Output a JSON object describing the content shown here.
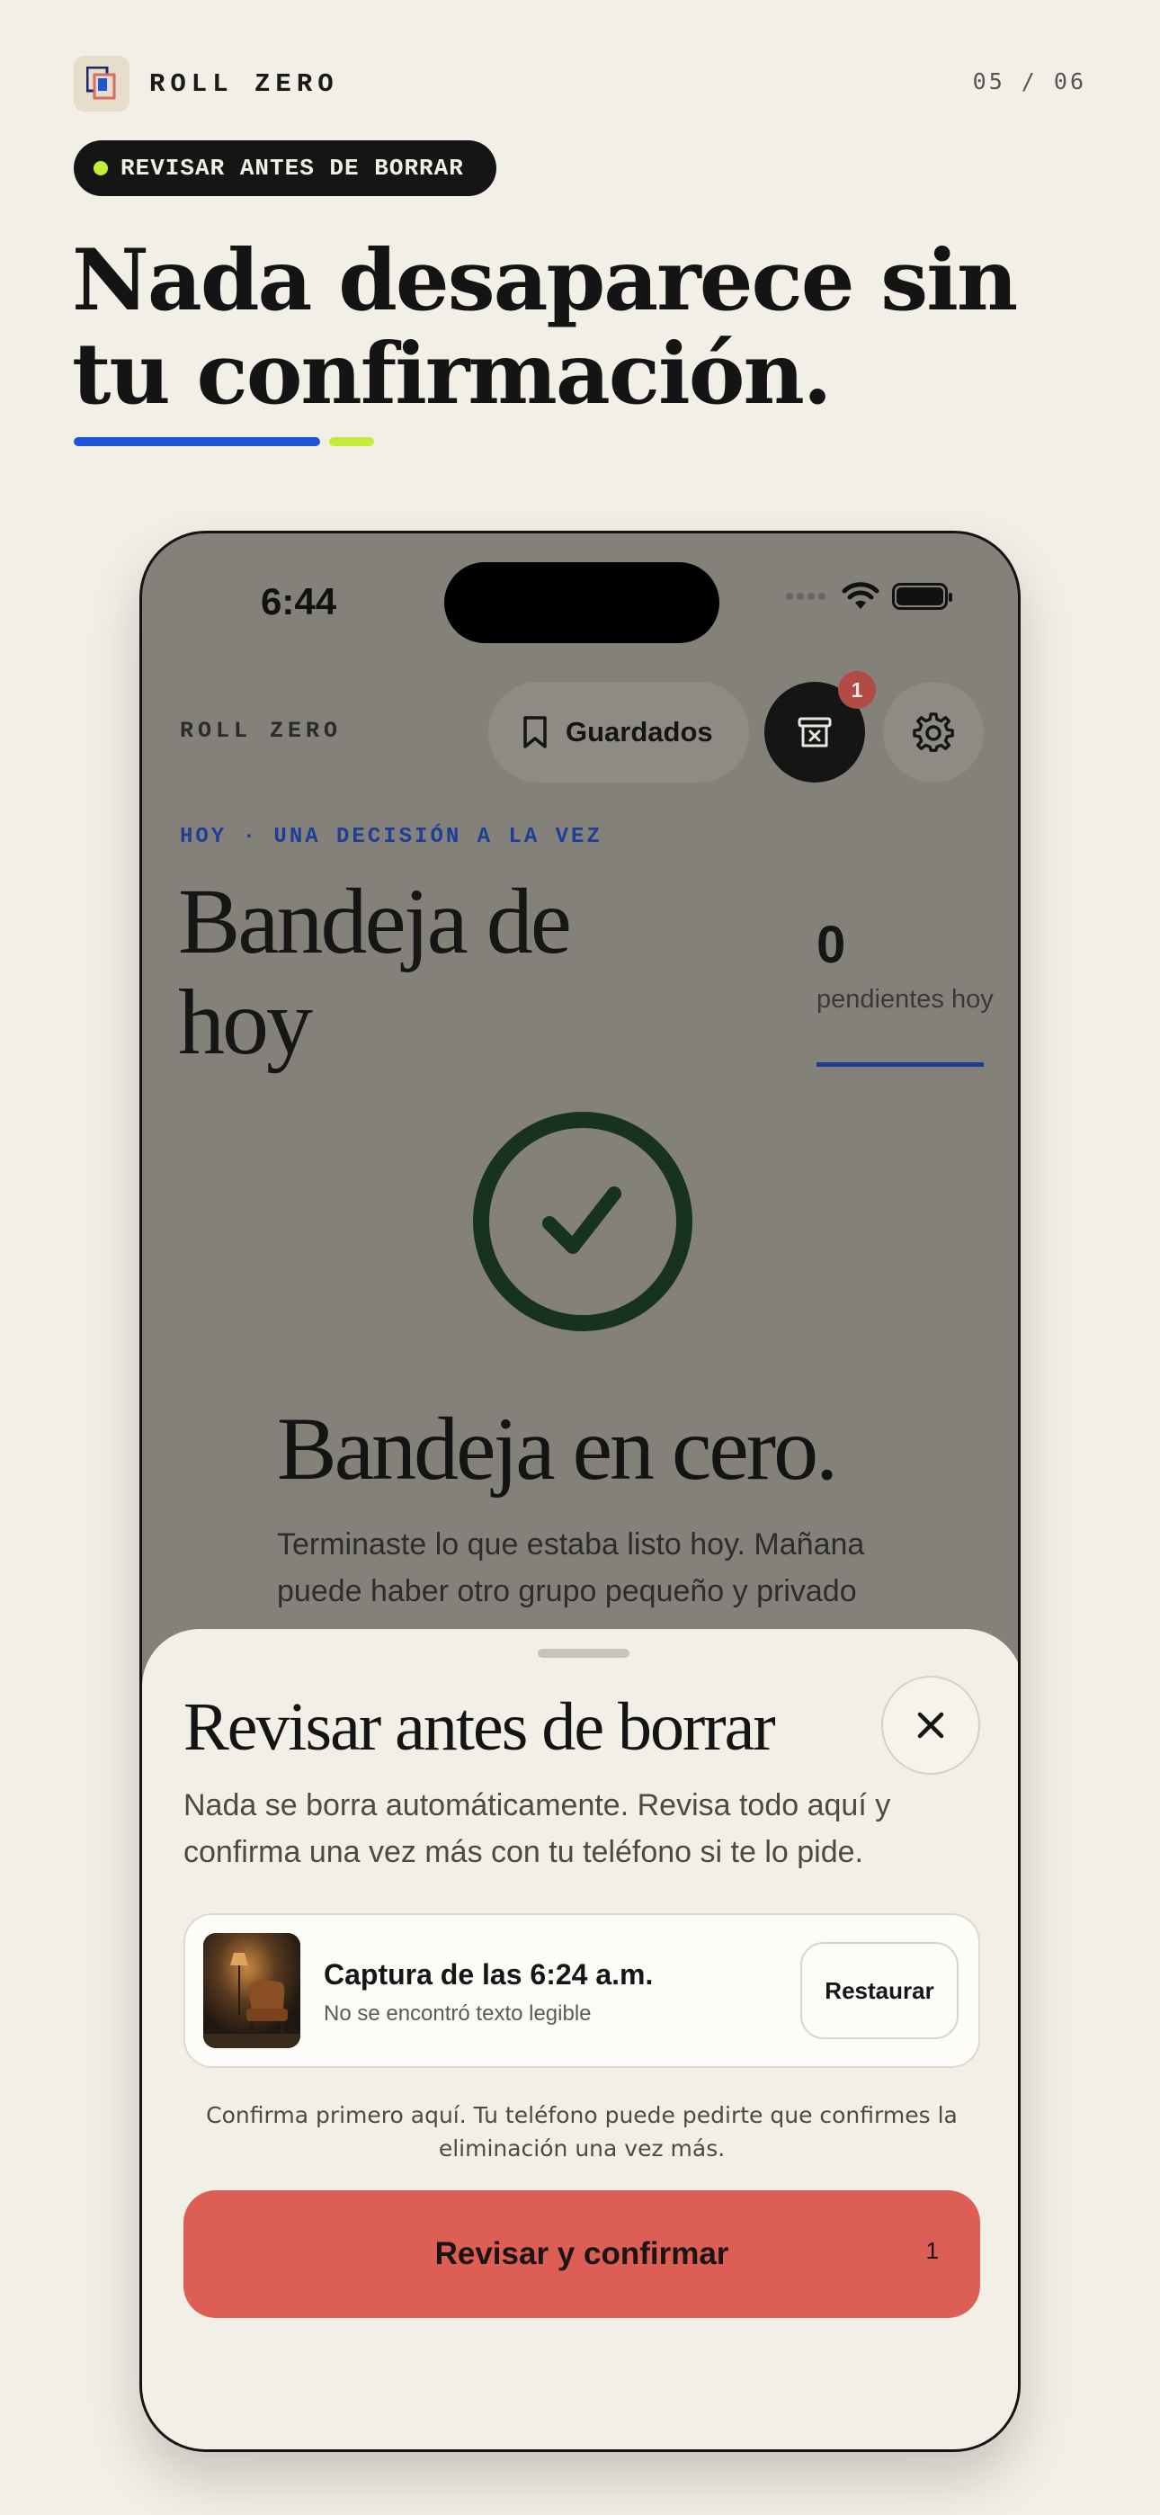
{
  "header": {
    "brand": "ROLL ZERO",
    "page_counter": "05 / 06",
    "pill_label": "REVISAR ANTES DE BORRAR",
    "headline": "Nada desaparece sin tu confirmación.",
    "accent_colors": {
      "blue": "#1d55d6",
      "lime": "#c4ec3b"
    }
  },
  "status_bar": {
    "time": "6:44"
  },
  "app": {
    "brand": "ROLL ZERO",
    "saved_button": "Guardados",
    "trash_badge": "1",
    "eyebrow": "HOY · UNA DECISIÓN A LA VEZ",
    "title": "Bandeja de hoy",
    "pending_count": "0",
    "pending_label": "pendientes hoy",
    "empty_title": "Bandeja en cero.",
    "empty_text": "Terminaste lo que estaba listo hoy. Mañana puede haber otro grupo pequeño y privado"
  },
  "sheet": {
    "title": "Revisar antes de borrar",
    "description": "Nada se borra automáticamente. Revisa todo aquí y confirma una vez más con tu teléfono si te lo pide.",
    "items": [
      {
        "title": "Captura de las 6:24 a.m.",
        "subtitle": "No se encontró texto legible",
        "action": "Restaurar"
      }
    ],
    "note": "Confirma primero aquí. Tu teléfono puede pedirte que confirmes la eliminación una vez más.",
    "confirm_button": "Revisar y confirmar",
    "confirm_count": "1",
    "confirm_color": "#dc5e54"
  },
  "icons": [
    "app-logo-icon",
    "bookmark-icon",
    "trash-x-icon",
    "gear-icon",
    "check-icon",
    "close-icon",
    "wifi-icon",
    "battery-icon"
  ]
}
